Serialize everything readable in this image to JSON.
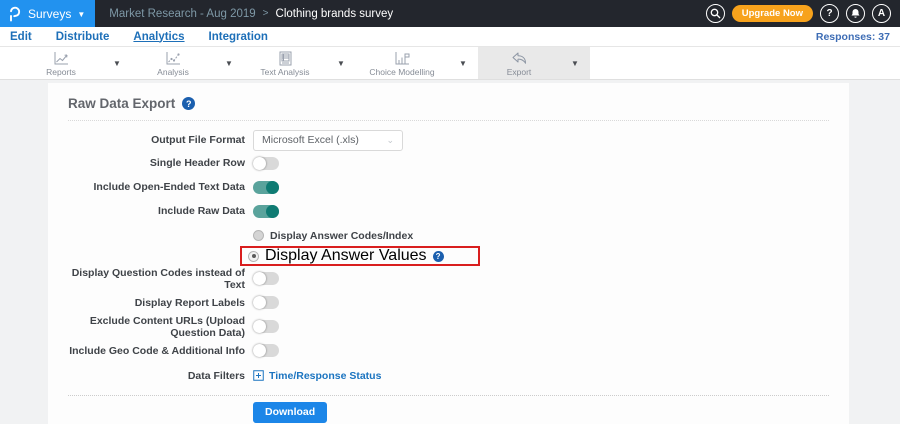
{
  "topbar": {
    "app_menu_label": "Surveys",
    "breadcrumb_parent": "Market Research - Aug 2019",
    "breadcrumb_separator": ">",
    "breadcrumb_current": "Clothing brands survey",
    "upgrade_label": "Upgrade Now",
    "avatar_letter": "A",
    "help_glyph": "?",
    "icons": [
      "questionpro-logo",
      "search-icon",
      "help-icon",
      "bell-icon",
      "avatar"
    ],
    "colors": {
      "bar": "#23262d",
      "logo_bg": "#2292ef",
      "upgrade_orange": "#f7a21c"
    }
  },
  "nav": {
    "items": [
      {
        "label": "Edit",
        "active": false
      },
      {
        "label": "Distribute",
        "active": false
      },
      {
        "label": "Analytics",
        "active": true
      },
      {
        "label": "Integration",
        "active": false
      }
    ],
    "responses_label": "Responses: 37",
    "link_color": "#1d6fb8"
  },
  "toolbar": {
    "items": [
      {
        "label": "Reports",
        "icon": "line-chart-icon",
        "active": false
      },
      {
        "label": "Analysis",
        "icon": "scatter-chart-icon",
        "active": false
      },
      {
        "label": "Text Analysis",
        "icon": "document-text-icon",
        "active": false
      },
      {
        "label": "Choice Modelling",
        "icon": "choice-chart-icon",
        "active": false
      },
      {
        "label": "Export",
        "icon": "export-arrow-icon",
        "active": true
      }
    ],
    "caret_glyph": "▼",
    "active_bg": "#e9e9e9"
  },
  "panel": {
    "title": "Raw Data Export",
    "output_format_label": "Output File Format",
    "output_format_value": "Microsoft Excel (.xls)",
    "toggles_top": [
      {
        "label": "Single Header Row",
        "on": false
      },
      {
        "label": "Include Open-Ended Text Data",
        "on": true
      },
      {
        "label": "Include Raw Data",
        "on": true
      }
    ],
    "radios": [
      {
        "label": "Display Answer Codes/Index",
        "selected": false,
        "highlighted": false
      },
      {
        "label": "Display Answer Values",
        "selected": true,
        "highlighted": true
      }
    ],
    "toggles_bottom": [
      {
        "label": "Display Question Codes instead of Text",
        "on": false
      },
      {
        "label": "Display Report Labels",
        "on": false
      },
      {
        "label": "Exclude Content URLs (Upload Question Data)",
        "on": false
      },
      {
        "label": "Include Geo Code & Additional Info",
        "on": false
      }
    ],
    "data_filters_label": "Data Filters",
    "data_filters_link": "Time/Response Status",
    "download_label": "Download",
    "colors": {
      "highlight_red": "#d91e1e",
      "toggle_on": "#5aa39c",
      "download_blue": "#1c86e8",
      "link_blue": "#1b74c0"
    }
  }
}
